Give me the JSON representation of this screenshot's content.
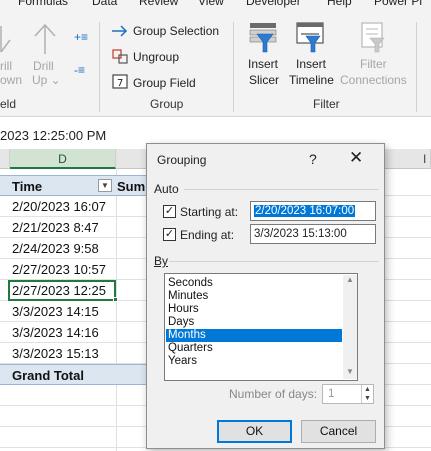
{
  "ribbon": {
    "tabs": [
      "Formulas",
      "Data",
      "Review",
      "View",
      "Developer",
      "Help",
      "Power Pi"
    ],
    "drill": {
      "left_top": "rill",
      "left_bottom": "own",
      "drill_label": "Drill",
      "up_label": "Up",
      "field_group": "eld"
    },
    "group": {
      "selection_label": "Group Selection",
      "ungroup_label": "Ungroup",
      "field_label": "Group Field",
      "group_name": "Group"
    },
    "filter": {
      "slicer_line1": "Insert",
      "slicer_line2": "Slicer",
      "timeline_line1": "Insert",
      "timeline_line2": "Timeline",
      "connections_line1": "Filter",
      "connections_line2": "Connections",
      "group_name": "Filter"
    }
  },
  "formula_bar": {
    "value": "2023  12:25:00 PM"
  },
  "sheet": {
    "column_d": "D",
    "header": {
      "time": "Time",
      "sum": "Sum"
    },
    "rows": [
      "2/20/2023 16:07",
      "2/21/2023 8:47",
      "2/24/2023 9:58",
      "2/27/2023 10:57",
      "2/27/2023 12:25",
      "3/3/2023 14:15",
      "3/3/2023 14:16",
      "3/3/2023 15:13"
    ],
    "grand_total": "Grand Total",
    "right_col_letter": "I"
  },
  "dialog": {
    "title": "Grouping",
    "help": "?",
    "close": "✕",
    "auto_label": "Auto",
    "starting_label": "Starting at:",
    "starting_value": "2/20/2023 16:07:00",
    "ending_label": "Ending at:",
    "ending_value": "3/3/2023 15:13:00",
    "by_label": "By",
    "by_options": [
      "Seconds",
      "Minutes",
      "Hours",
      "Days",
      "Months",
      "Quarters",
      "Years"
    ],
    "selected_option": "Months",
    "number_of_days_label": "Number of days:",
    "number_of_days_value": "1",
    "ok_label": "OK",
    "cancel_label": "Cancel"
  },
  "colors": {
    "accent": "#0078d7",
    "selection_green": "#1f7a3f",
    "header_blue": "#dce6f1"
  }
}
